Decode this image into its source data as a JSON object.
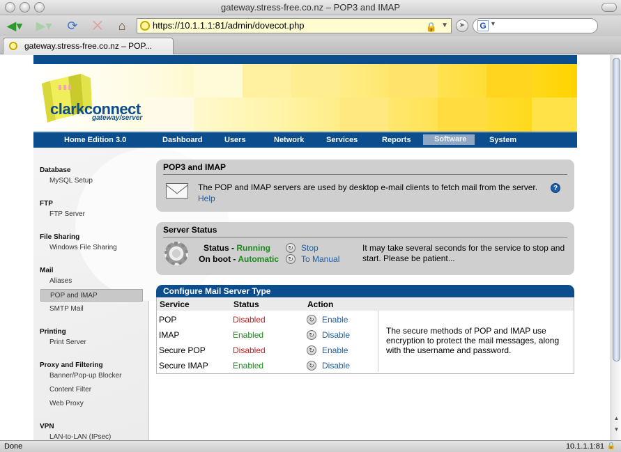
{
  "window": {
    "title": "gateway.stress-free.co.nz – POP3 and IMAP"
  },
  "browser": {
    "url": "https://10.1.1.1:81/admin/dovecot.php",
    "search_engine": "G",
    "tab_label": "gateway.stress-free.co.nz – POP...",
    "status_left": "Done",
    "status_right": "10.1.1.1:81"
  },
  "brand": {
    "name": "clarkconnect",
    "tagline": "gateway/server"
  },
  "nav": {
    "edition": "Home Edition 3.0",
    "items": [
      "Dashboard",
      "Users",
      "Network",
      "Services",
      "Reports",
      "Software",
      "System"
    ],
    "active": "Software"
  },
  "sidebar": {
    "sections": [
      {
        "heading": "Database",
        "items": [
          "MySQL Setup"
        ]
      },
      {
        "heading": "FTP",
        "items": [
          "FTP Server"
        ]
      },
      {
        "heading": "File Sharing",
        "items": [
          "Windows File Sharing"
        ]
      },
      {
        "heading": "Mail",
        "items": [
          "Aliases",
          "POP and IMAP",
          "SMTP Mail"
        ]
      },
      {
        "heading": "Printing",
        "items": [
          "Print Server"
        ]
      },
      {
        "heading": "Proxy and Filtering",
        "items": [
          "Banner/Pop-up Blocker",
          "Content Filter",
          "Web Proxy"
        ]
      },
      {
        "heading": "VPN",
        "items": [
          "LAN-to-LAN (IPsec)"
        ]
      }
    ],
    "selected": "POP and IMAP"
  },
  "intro": {
    "title": "POP3 and IMAP",
    "description": "The POP and IMAP servers are used by desktop e-mail clients to fetch mail from the server.",
    "help_link": "Help",
    "help_badge": "?"
  },
  "server_status": {
    "title": "Server Status",
    "status_label": "Status -",
    "status_value": "Running",
    "onboot_label": "On boot -",
    "onboot_value": "Automatic",
    "stop_action": "Stop",
    "manual_action": "To Manual",
    "note": "It may take several seconds for the service to stop and start.  Please be patient..."
  },
  "config": {
    "title": "Configure Mail Server Type",
    "columns": [
      "Service",
      "Status",
      "Action"
    ],
    "rows": [
      {
        "service": "POP",
        "status": "Disabled",
        "action": "Enable"
      },
      {
        "service": "IMAP",
        "status": "Enabled",
        "action": "Disable"
      },
      {
        "service": "Secure POP",
        "status": "Disabled",
        "action": "Enable"
      },
      {
        "service": "Secure IMAP",
        "status": "Enabled",
        "action": "Disable"
      }
    ],
    "note": "The secure methods of POP and IMAP use encryption to protect the mail messages, along with the username and password."
  },
  "colors": {
    "brand_blue": "#0b4d8d",
    "link": "#1b5ea6",
    "enabled": "#1b8a1b",
    "disabled": "#c41f1f",
    "banner_yellow": "#ffd400"
  },
  "icons": [
    "back-icon",
    "forward-icon",
    "reload-icon",
    "stop-icon",
    "home-icon",
    "lock-icon",
    "mail-icon",
    "gear-icon",
    "help-icon",
    "action-icon"
  ]
}
